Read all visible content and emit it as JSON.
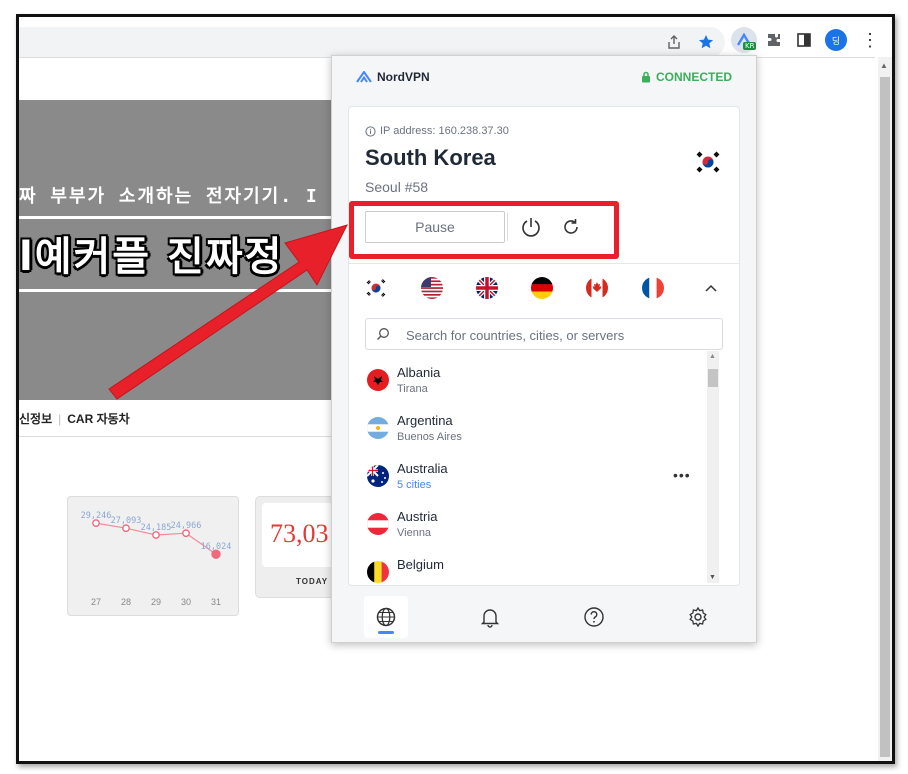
{
  "browser": {
    "extension_badge": "KR",
    "profile_initial": "딩"
  },
  "webpage": {
    "banner_line1": "짜 부부가 소개하는 전자기기. I",
    "banner_line2": "l예커플 진짜정",
    "nav": [
      "신정보",
      "CAR 자동차"
    ],
    "chart_data": {
      "type": "line",
      "categories": [
        "27",
        "28",
        "29",
        "30",
        "31"
      ],
      "values": [
        29246,
        27093,
        24185,
        24966,
        16024
      ],
      "labels": [
        "29,246",
        "27,093",
        "24,185",
        "24,966",
        "16,024"
      ],
      "ylim": [
        14000,
        31000
      ]
    },
    "today_value": "73,03",
    "today_label": "TODAY"
  },
  "vpn": {
    "brand": "NordVPN",
    "status": "CONNECTED",
    "ip_label": "IP address: 160.238.37.30",
    "country": "South Korea",
    "server": "Seoul #58",
    "pause_label": "Pause",
    "quick_flags": [
      "korea-flag",
      "usa-flag",
      "uk-flag",
      "germany-flag",
      "canada-flag",
      "france-flag"
    ],
    "search_placeholder": "Search for countries, cities, or servers",
    "countries": [
      {
        "name": "Albania",
        "sub": "Tirana"
      },
      {
        "name": "Argentina",
        "sub": "Buenos Aires"
      },
      {
        "name": "Australia",
        "sub": "5 cities"
      },
      {
        "name": "Austria",
        "sub": "Vienna"
      },
      {
        "name": "Belgium",
        "sub": ""
      }
    ],
    "bottom_nav": [
      "globe-icon",
      "bell-icon",
      "help-icon",
      "settings-icon"
    ],
    "colors": {
      "connected": "#3baf5a",
      "accent": "#4687ff",
      "highlight": "#e8202a"
    }
  }
}
